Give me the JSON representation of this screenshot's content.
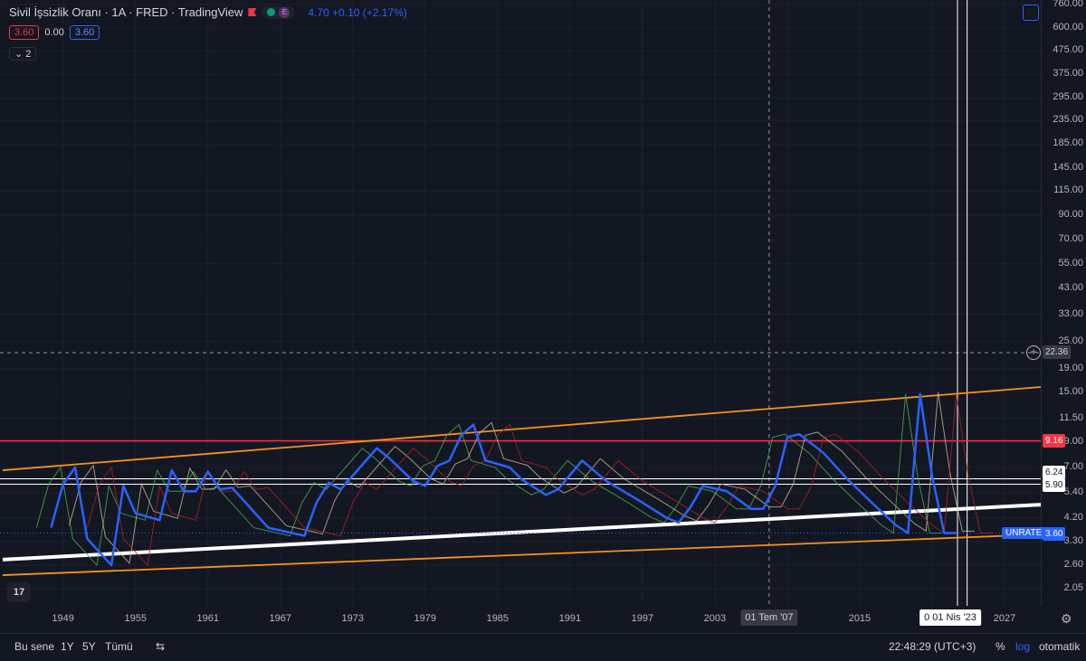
{
  "legend": {
    "title": "Sivil İşsizlik Oranı · 1A · FRED · TradingView",
    "e_badge": "E",
    "price_info": "4.70 +0.10 (+2.17%)",
    "values": [
      "3.60",
      "0.00",
      "3.60"
    ],
    "collapse_count": "2",
    "tv_logo": "17"
  },
  "price_axis": {
    "ticks": [
      "760.00",
      "600.00",
      "475.00",
      "375.00",
      "295.00",
      "235.00",
      "185.00",
      "145.00",
      "115.00",
      "90.00",
      "70.00",
      "55.00",
      "43.00",
      "33.00",
      "25.00",
      "19.00",
      "15.00",
      "11.50",
      "9.00",
      "7.00",
      "5.40",
      "4.20",
      "3.30",
      "2.60",
      "2.05"
    ],
    "labels": {
      "crosshair": "22.36",
      "red_line": "9.16",
      "white_a": "6.24",
      "white_b": "5.90",
      "unrate_name": "UNRATE",
      "unrate_value": "3.60"
    }
  },
  "time_axis": {
    "ticks": [
      "1949",
      "1955",
      "1961",
      "1967",
      "1973",
      "1979",
      "1985",
      "1991",
      "1997",
      "2003",
      "2015",
      "2027"
    ],
    "crosshair_label": "01 Tem '07",
    "cursor_label": "0 01 Nis '23"
  },
  "bottom_bar": {
    "ranges": [
      "Bu sene",
      "1Y",
      "5Y",
      "Tümü"
    ],
    "clock": "22:48:29 (UTC+3)",
    "percent": "%",
    "log": "log",
    "auto": "otomatik"
  },
  "colors": {
    "background": "#131722",
    "main_series": "#2962ff",
    "red_line": "#f23645",
    "orange_channel": "#f7931a",
    "trend_white": "#ffffff",
    "green_series": "#4caf50",
    "tan_series": "#c8b89a",
    "darkred_series": "#b22222"
  },
  "chart_data": {
    "type": "line",
    "scale": "log",
    "x_range": [
      1944,
      2030
    ],
    "series": [
      {
        "name": "UNRATE",
        "x": [
          1948,
          1949,
          1950,
          1951,
          1953,
          1954,
          1955,
          1957,
          1958,
          1959,
          1960,
          1961,
          1962,
          1963,
          1966,
          1968,
          1969,
          1970,
          1971,
          1972,
          1975,
          1976,
          1978,
          1979,
          1980,
          1981,
          1982,
          1983,
          1984,
          1986,
          1987,
          1989,
          1990,
          1992,
          1994,
          1997,
          1999,
          2000,
          2001,
          2002,
          2004,
          2006,
          2007,
          2008,
          2009,
          2010,
          2012,
          2014,
          2016,
          2018,
          2019,
          2020,
          2021,
          2022,
          2023
        ],
        "values": [
          3.8,
          5.9,
          7.0,
          3.4,
          2.6,
          5.8,
          4.4,
          4.1,
          6.8,
          5.5,
          5.5,
          6.7,
          5.6,
          5.7,
          3.8,
          3.6,
          3.5,
          4.9,
          6.0,
          5.6,
          8.5,
          7.7,
          6.1,
          5.8,
          7.1,
          7.5,
          9.7,
          10.8,
          7.5,
          7.0,
          6.2,
          5.3,
          5.6,
          7.5,
          6.1,
          4.9,
          4.2,
          4.0,
          4.7,
          5.8,
          5.5,
          4.6,
          4.6,
          5.8,
          9.5,
          9.8,
          8.1,
          6.2,
          4.9,
          3.9,
          3.6,
          14.7,
          6.4,
          3.6,
          3.6
        ]
      }
    ],
    "horizontal_lines": [
      9.16,
      6.24,
      5.9
    ],
    "trend_lines": [
      {
        "name": "orange-upper",
        "from": [
          1944,
          6.8
        ],
        "to": [
          2030,
          15.8
        ]
      },
      {
        "name": "orange-lower",
        "from": [
          1944,
          2.35
        ],
        "to": [
          2030,
          3.55
        ]
      },
      {
        "name": "white-trend",
        "from": [
          1944,
          2.75
        ],
        "to": [
          2030,
          4.8
        ]
      }
    ],
    "crosshair": {
      "x_label": "01 Tem '07",
      "y_value": 22.36
    }
  }
}
